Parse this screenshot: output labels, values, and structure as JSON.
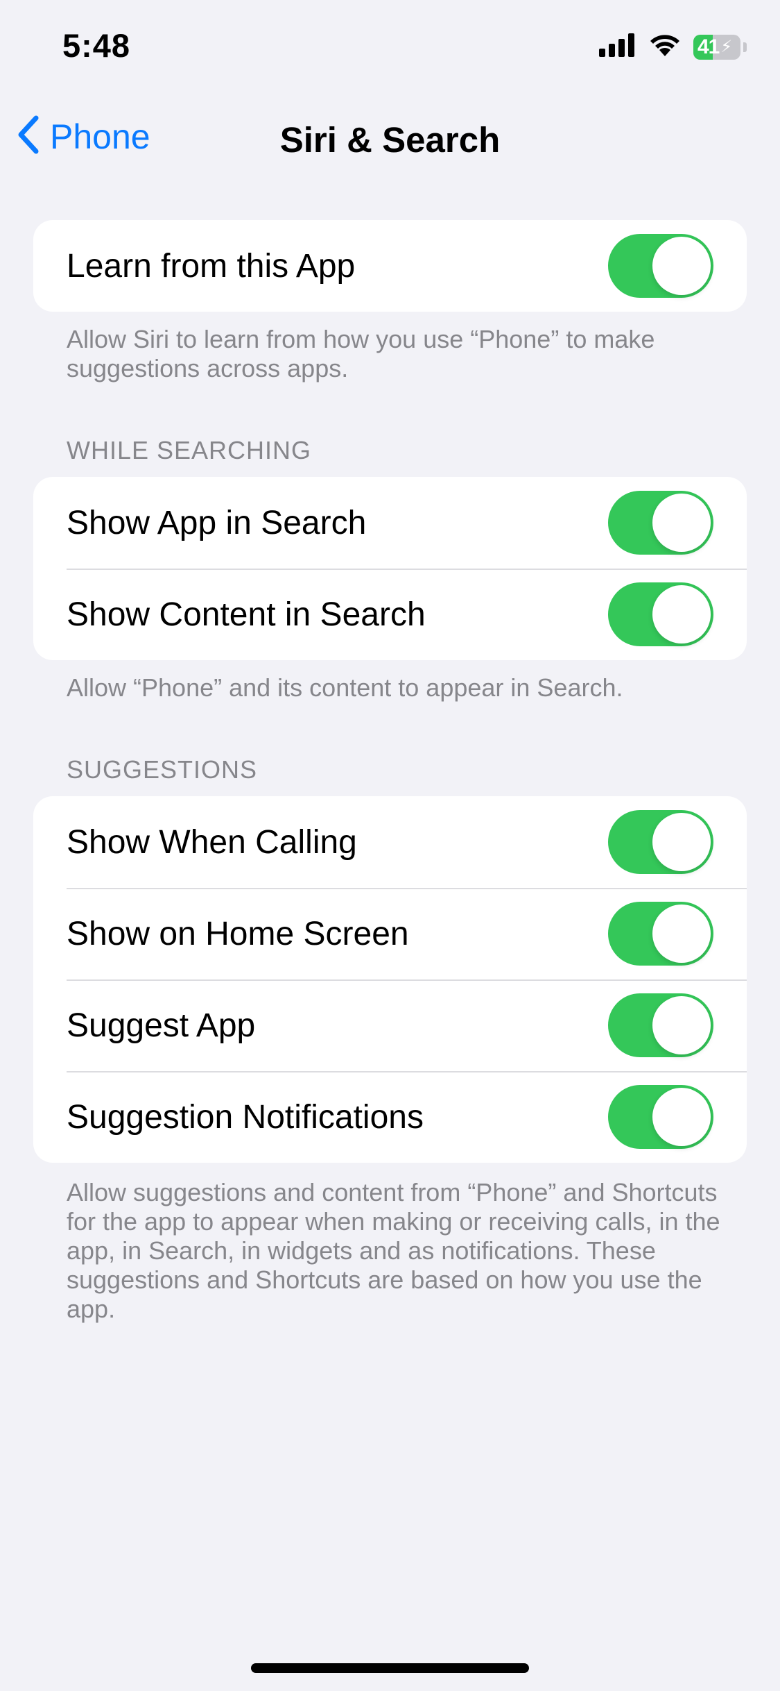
{
  "status": {
    "time": "5:48",
    "battery_level": "41",
    "battery_fraction": 0.41,
    "icons": [
      "cellular-signal-icon",
      "wifi-icon",
      "battery-charging-icon"
    ]
  },
  "nav": {
    "back_label": "Phone",
    "title": "Siri & Search"
  },
  "colors": {
    "accent": "#0a7aff",
    "toggle_on": "#34c759",
    "background": "#f2f2f7",
    "secondary_text": "#86868b"
  },
  "learn": {
    "label": "Learn from this App",
    "enabled": true,
    "footer": "Allow Siri to learn from how you use “Phone” to make suggestions across apps."
  },
  "while_searching": {
    "header": "WHILE SEARCHING",
    "rows": [
      {
        "label": "Show App in Search",
        "enabled": true
      },
      {
        "label": "Show Content in Search",
        "enabled": true
      }
    ],
    "footer": "Allow “Phone” and its content to appear in Search."
  },
  "suggestions": {
    "header": "SUGGESTIONS",
    "rows": [
      {
        "label": "Show When Calling",
        "enabled": true
      },
      {
        "label": "Show on Home Screen",
        "enabled": true
      },
      {
        "label": "Suggest App",
        "enabled": true
      },
      {
        "label": "Suggestion Notifications",
        "enabled": true
      }
    ],
    "footer": "Allow suggestions and content from “Phone” and Shortcuts for the app to appear when making or receiving calls, in the app, in Search, in widgets and as notifications. These suggestions and Shortcuts are based on how you use the app."
  }
}
